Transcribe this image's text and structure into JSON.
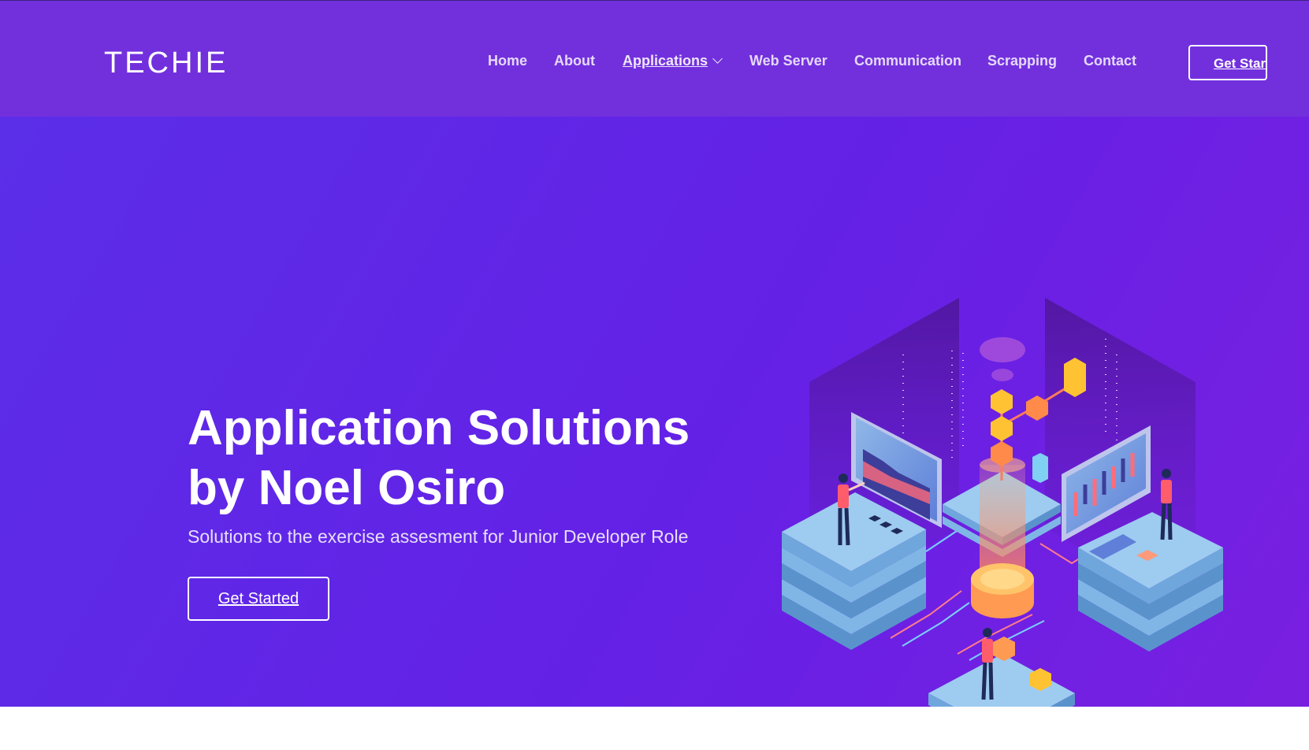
{
  "header": {
    "logo": "TECHIE",
    "nav": [
      {
        "label": "Home"
      },
      {
        "label": "About"
      },
      {
        "label": "Applications"
      },
      {
        "label": "Web Server"
      },
      {
        "label": "Communication"
      },
      {
        "label": "Scrapping"
      },
      {
        "label": "Contact"
      }
    ],
    "cta_label": "Get Started"
  },
  "hero": {
    "title_line1": "Application Solutions",
    "title_line2": "by Noel Osiro",
    "subtitle": "Solutions to the exercise assesment for Junior Developer Role",
    "cta_label": "Get Started"
  },
  "colors": {
    "header_bg": "#7230dd",
    "hero_gradient_start": "#5a2fe8",
    "hero_gradient_end": "#7a1fe0",
    "platform": "#9ecbf0",
    "accent_orange": "#ff8a4a",
    "accent_yellow": "#ffc233"
  },
  "icons": {
    "dropdown": "chevron-down-icon"
  }
}
